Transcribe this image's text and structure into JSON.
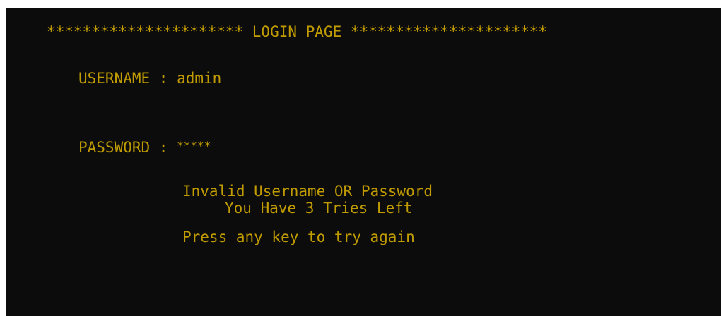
{
  "console": {
    "background": "#0c0c0c",
    "text_color": "#c19c00",
    "banner": "********************** LOGIN PAGE **********************",
    "username": {
      "label": "USERNAME",
      "separator": " : ",
      "value": "admin"
    },
    "password": {
      "label": "PASSWORD",
      "separator": " : ",
      "masked_value": "*****"
    },
    "messages": {
      "error": "Invalid Username OR Password",
      "tries": "You Have 3 Tries Left",
      "prompt": "Press any key to try again"
    }
  }
}
